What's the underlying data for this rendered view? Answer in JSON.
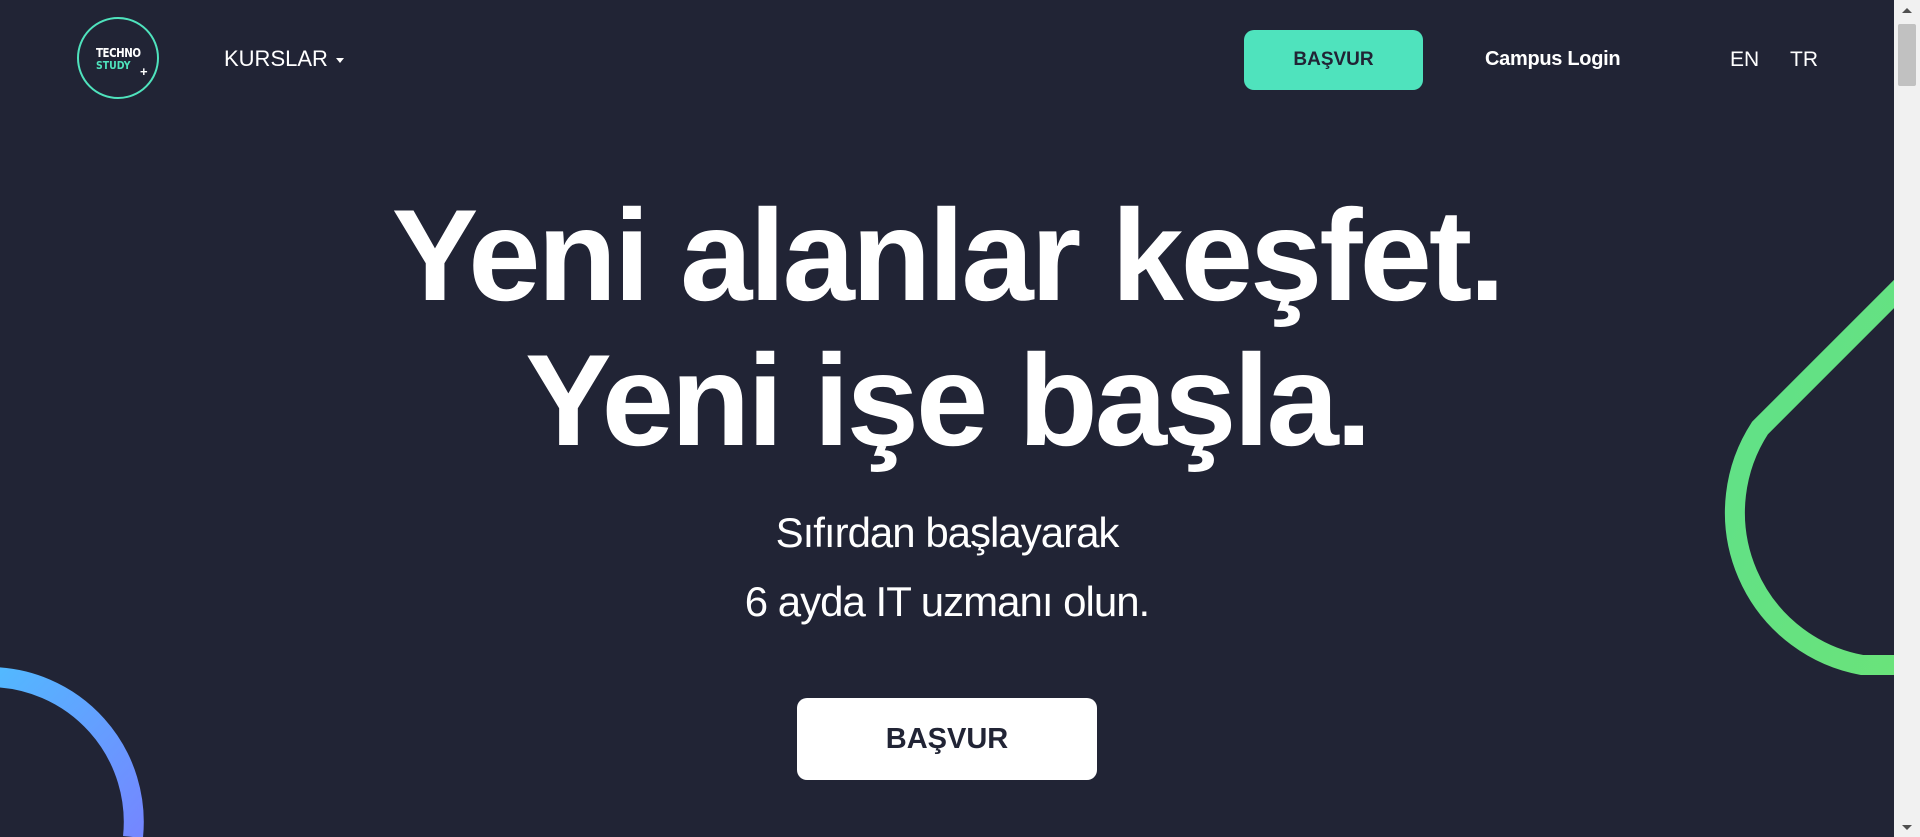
{
  "header": {
    "logo": {
      "line1": "TECHNO",
      "line2": "STUDY",
      "plus": "+"
    },
    "courses_label": "KURSLAR",
    "apply_label": "BAŞVUR",
    "campus_login_label": "Campus Login",
    "languages": [
      "EN",
      "TR"
    ]
  },
  "hero": {
    "line1": "Yeni alanlar keşfet.",
    "line2": "Yeni işe başla.",
    "sub1": "Sıfırdan başlayarak",
    "sub2": "6 ayda IT uzmanı olun.",
    "cta_label": "BAŞVUR"
  },
  "colors": {
    "background": "#212435",
    "accent": "#4fe3bd",
    "green_ring": "#63e27d",
    "blue_ring": "#6f8bff",
    "white": "#ffffff"
  },
  "icons": {
    "courses_dropdown": "caret-down-icon",
    "scroll_up": "arrow-up-icon",
    "scroll_down": "arrow-down-icon"
  }
}
